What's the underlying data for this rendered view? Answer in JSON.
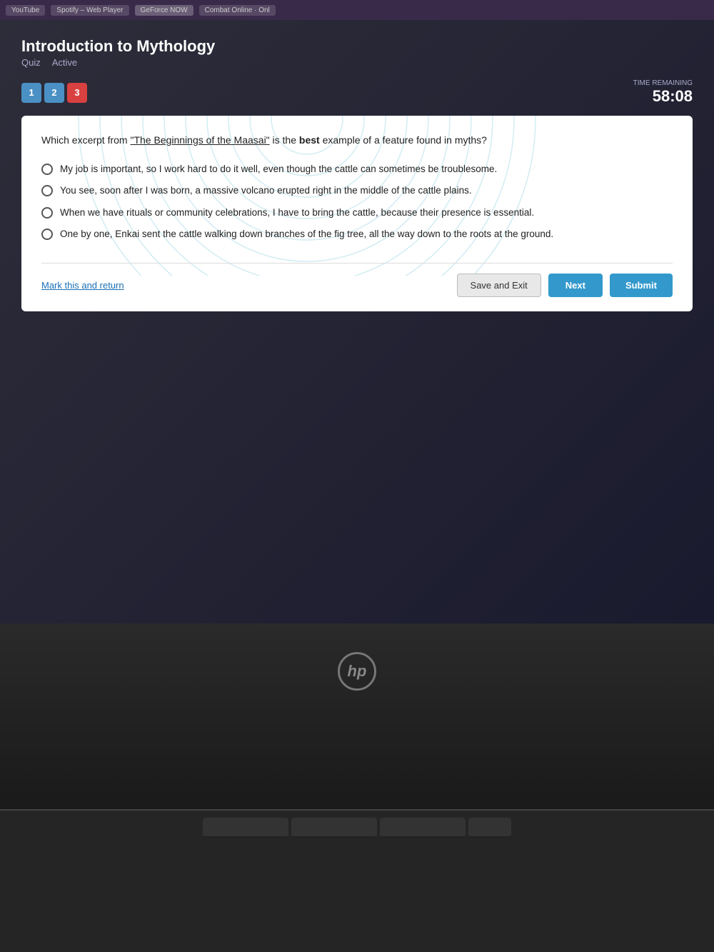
{
  "browser": {
    "tabs": [
      {
        "label": "YouTube",
        "active": false
      },
      {
        "label": "Spotify – Web Player",
        "active": false
      },
      {
        "label": "GeForce NOW",
        "active": false
      },
      {
        "label": "Combat Online · Onl",
        "active": false
      }
    ]
  },
  "page": {
    "title": "Introduction to Mythology",
    "subtitle_type": "Quiz",
    "subtitle_status": "Active"
  },
  "timer": {
    "label": "TIME REMAINING",
    "value": "58:08"
  },
  "question_nav": {
    "numbers": [
      {
        "num": "1",
        "state": "answered"
      },
      {
        "num": "2",
        "state": "answered"
      },
      {
        "num": "3",
        "state": "current"
      }
    ]
  },
  "question": {
    "text_pre": "Which excerpt from ",
    "source_title": "\"The Beginnings of the Maasai\"",
    "text_post": " is the ",
    "emphasis": "best",
    "text_end": " example of a feature found in myths?"
  },
  "answers": [
    {
      "id": "a",
      "text": "My job is important, so I work hard to do it well, even though the cattle can sometimes be troublesome."
    },
    {
      "id": "b",
      "text": "You see, soon after I was born, a massive volcano erupted right in the middle of the cattle plains."
    },
    {
      "id": "c",
      "text": "When we have rituals or community celebrations, I have to bring the cattle, because their presence is essential."
    },
    {
      "id": "d",
      "text": "One by one, Enkai sent the cattle walking down branches of the fig tree, all the way down to the roots at the ground."
    }
  ],
  "footer": {
    "mark_return": "Mark this and return",
    "save_exit": "Save and Exit",
    "next": "Next",
    "submit": "Submit"
  },
  "hp_logo": "hp"
}
